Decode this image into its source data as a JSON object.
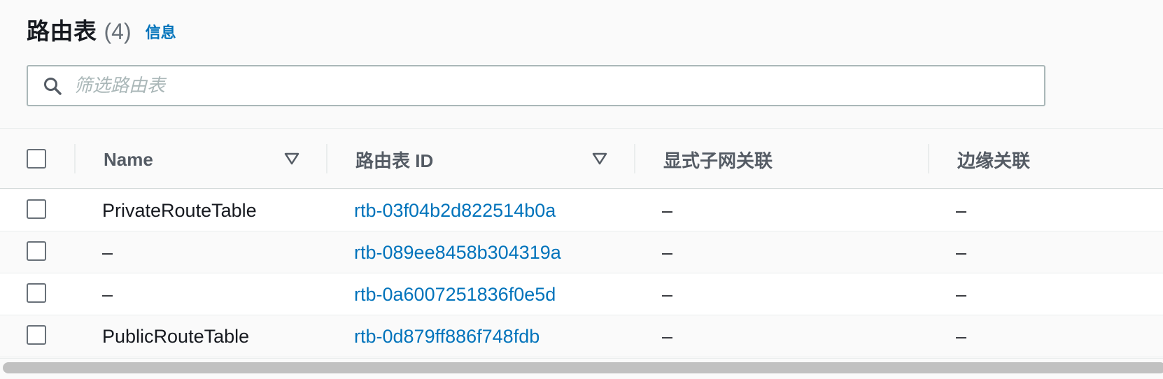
{
  "header": {
    "title": "路由表",
    "count": "(4)",
    "info_link": "信息"
  },
  "filter": {
    "placeholder": "筛选路由表",
    "value": "",
    "icon": "search-icon"
  },
  "table": {
    "columns": [
      {
        "label": "Name",
        "sortable": true
      },
      {
        "label": "路由表 ID",
        "sortable": true
      },
      {
        "label": "显式子网关联",
        "sortable": false
      },
      {
        "label": "边缘关联",
        "sortable": false
      }
    ],
    "rows": [
      {
        "name": "PrivateRouteTable",
        "id": "rtb-03f04b2d822514b0a",
        "explicit_subnet": "–",
        "edge": "–"
      },
      {
        "name": "–",
        "id": "rtb-089ee8458b304319a",
        "explicit_subnet": "–",
        "edge": "–"
      },
      {
        "name": "–",
        "id": "rtb-0a6007251836f0e5d",
        "explicit_subnet": "–",
        "edge": "–"
      },
      {
        "name": "PublicRouteTable",
        "id": "rtb-0d879ff886f748fdb",
        "explicit_subnet": "–",
        "edge": "–"
      }
    ]
  },
  "colors": {
    "link": "#0073bb",
    "text": "#16191f",
    "muted": "#687078",
    "header_text": "#545b64"
  }
}
